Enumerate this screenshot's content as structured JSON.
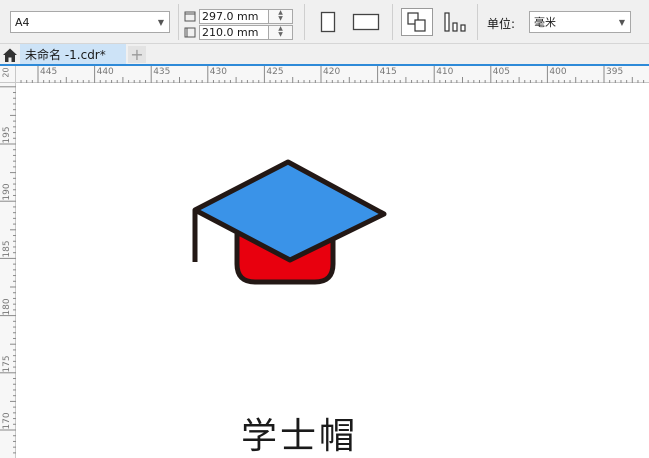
{
  "toolbar": {
    "page_size": "A4",
    "width_value": "297.0 mm",
    "height_value": "210.0 mm",
    "unit_label": "单位:",
    "unit_value": "毫米"
  },
  "tabs": {
    "document_title": "未命名 -1.cdr*",
    "add_tab_glyph": "+"
  },
  "ruler": {
    "horizontal_ticks": [
      "445",
      "440",
      "435",
      "430",
      "425",
      "420",
      "415",
      "410",
      "405",
      "400",
      "395"
    ],
    "vertical_ticks": [
      "195",
      "190",
      "185",
      "180",
      "175",
      "170"
    ],
    "corner_tick": "20"
  },
  "artwork": {
    "title": "学士帽",
    "cap_top_color": "#3a93e8",
    "cap_base_color": "#e8000e",
    "outline_color": "#231815"
  },
  "icons": {
    "home": "home-icon",
    "portrait": "portrait-page-icon",
    "landscape": "landscape-page-icon",
    "all_pages": "all-pages-icon",
    "current_page": "current-page-icon"
  }
}
